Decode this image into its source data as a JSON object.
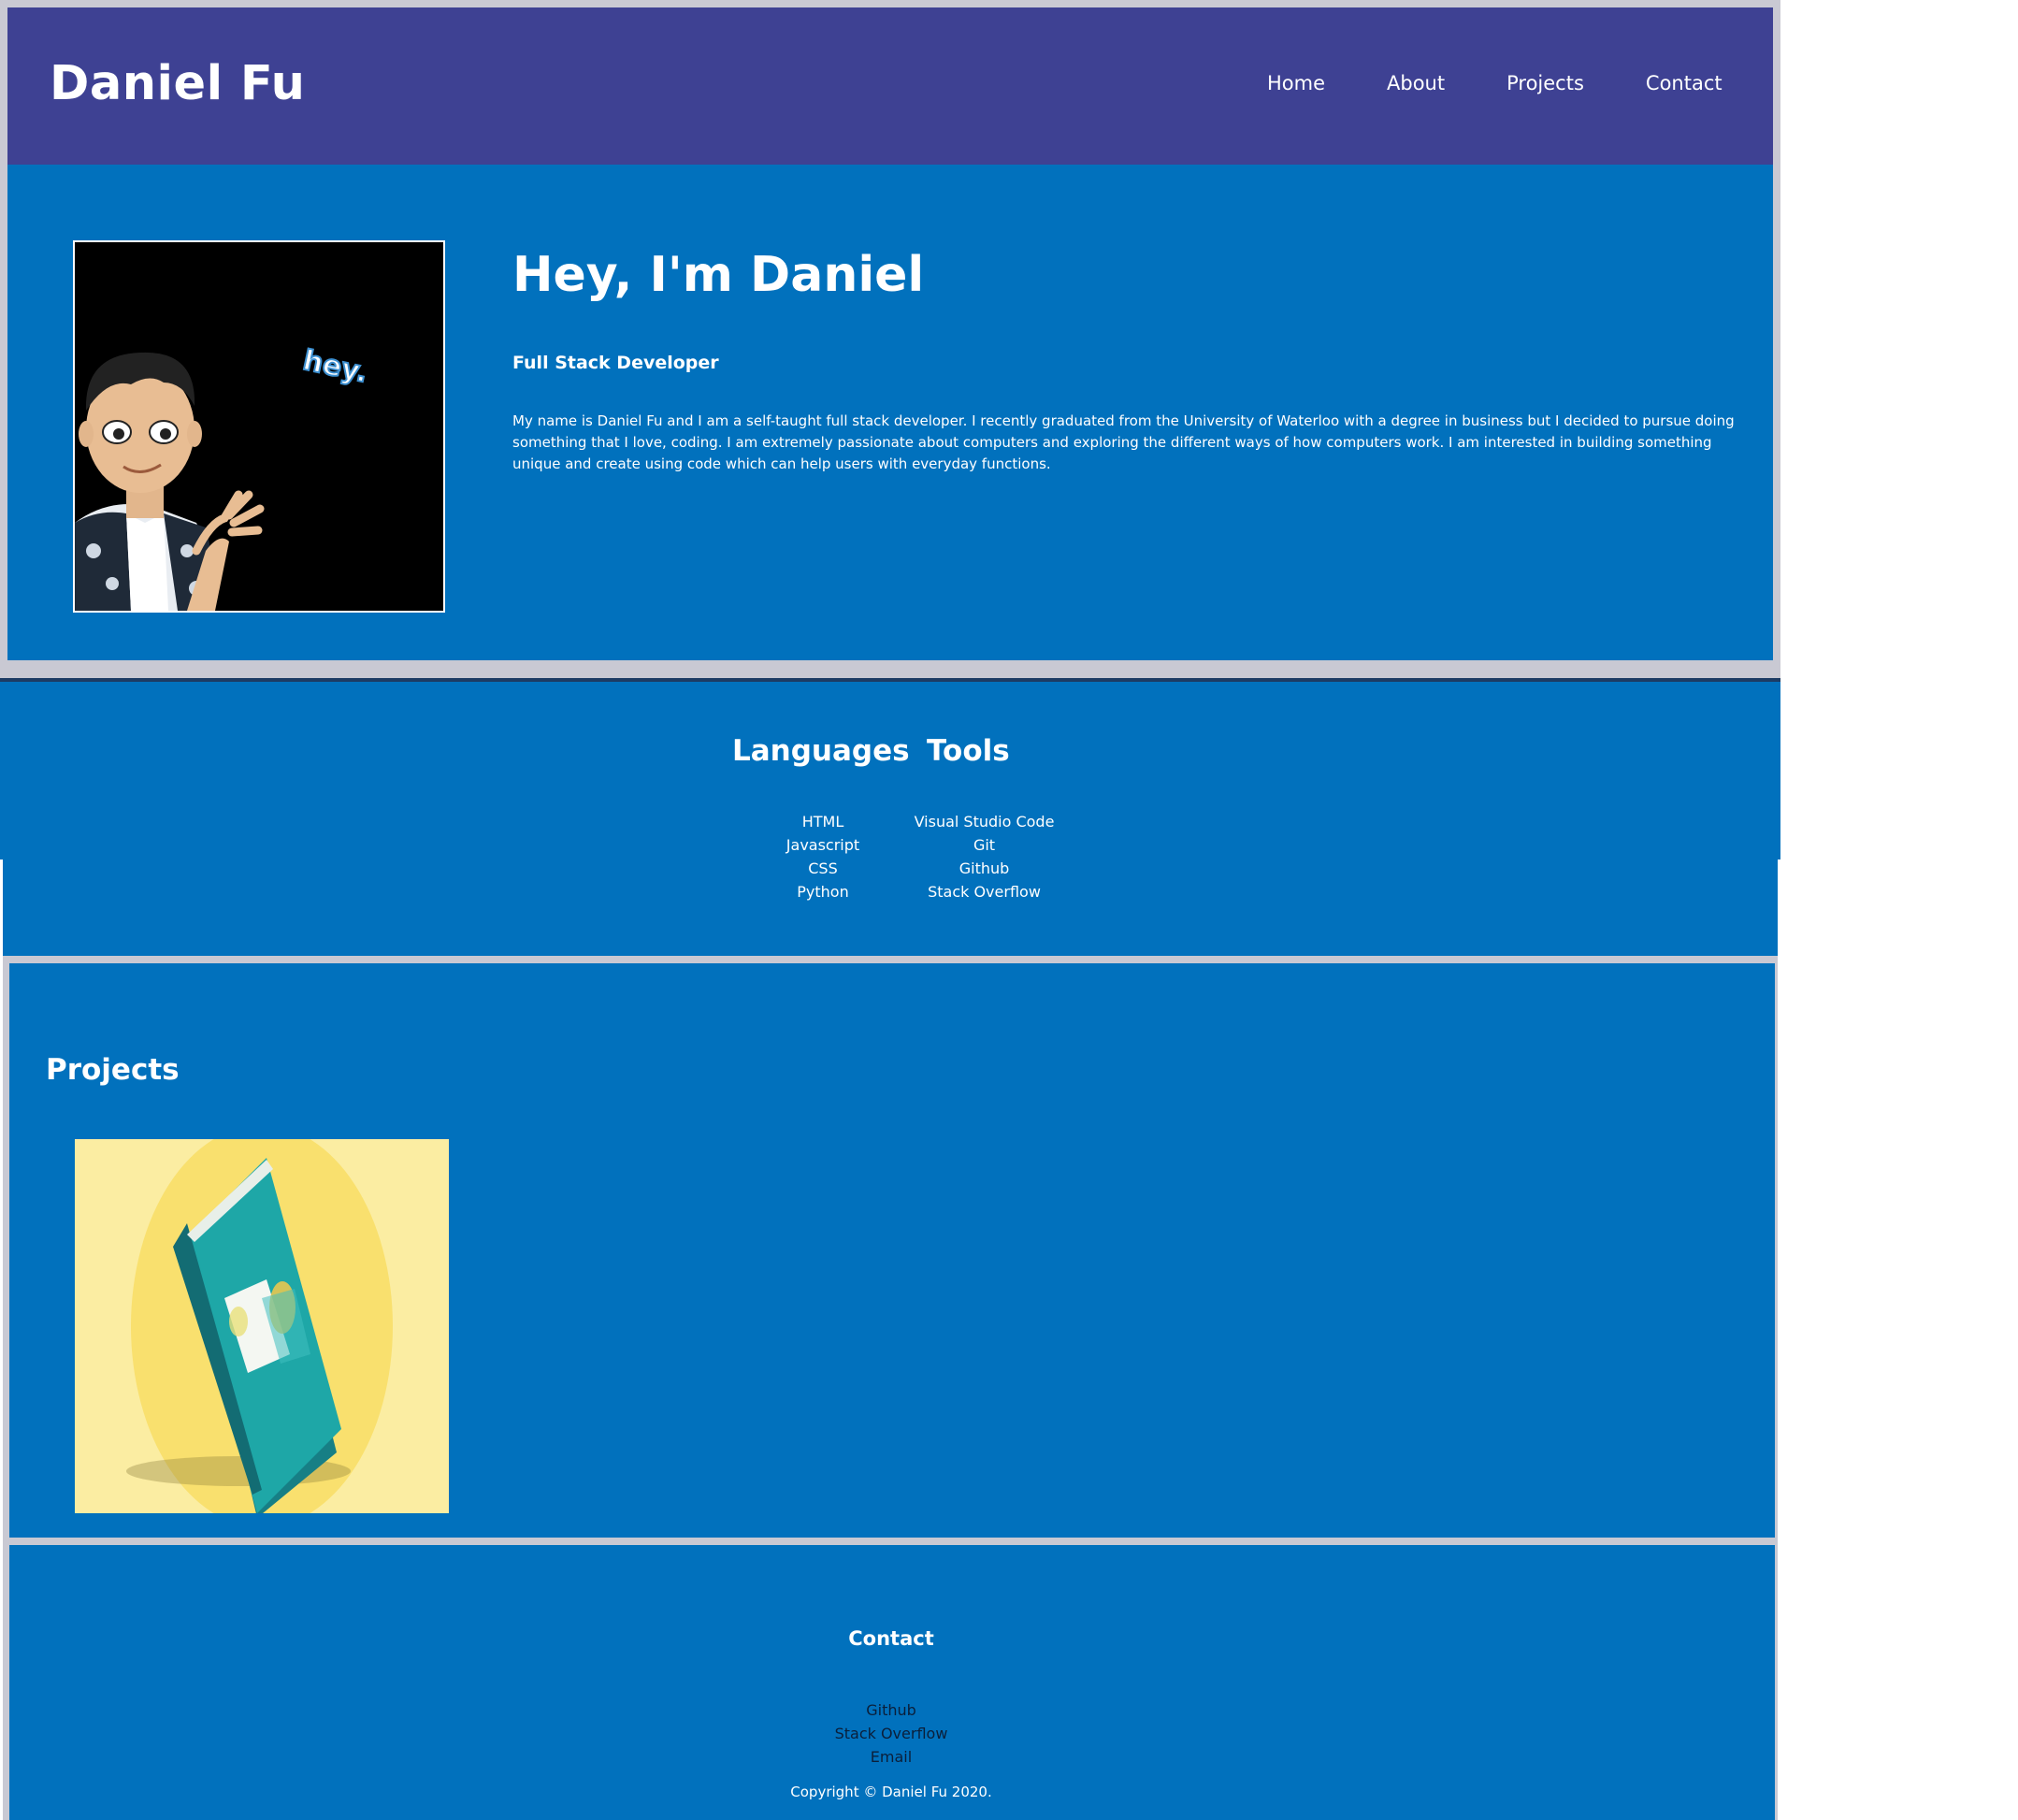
{
  "header": {
    "site_title": "Daniel Fu",
    "nav": [
      {
        "label": "Home"
      },
      {
        "label": "About"
      },
      {
        "label": "Projects"
      },
      {
        "label": "Contact"
      }
    ]
  },
  "hero": {
    "heading": "Hey, I'm Daniel",
    "subtitle": "Full Stack Developer",
    "bio": "My name is Daniel Fu and I am a self-taught full stack developer. I recently graduated from the University of Waterloo with a degree in business but I decided to pursue doing something that I love, coding. I am extremely passionate about computers and exploring the different ways of how computers work. I am interested in building something unique and create using code which can help users with everyday functions.",
    "avatar_text": "hey."
  },
  "skills": {
    "languages": {
      "title": "Languages",
      "items": [
        "HTML",
        "Javascript",
        "CSS",
        "Python"
      ]
    },
    "tools": {
      "title": "Tools",
      "items": [
        "Visual Studio Code",
        "Git",
        "Github",
        "Stack Overflow"
      ]
    }
  },
  "projects": {
    "heading": "Projects"
  },
  "contact": {
    "heading": "Contact",
    "links": [
      "Github",
      "Stack Overflow",
      "Email"
    ],
    "copyright": "Copyright © Daniel Fu 2020."
  },
  "colors": {
    "header_bg": "#3e4193",
    "section_bg": "#0171bd",
    "frame": "#c9c9d3",
    "link_dark": "#0b1f3a"
  }
}
